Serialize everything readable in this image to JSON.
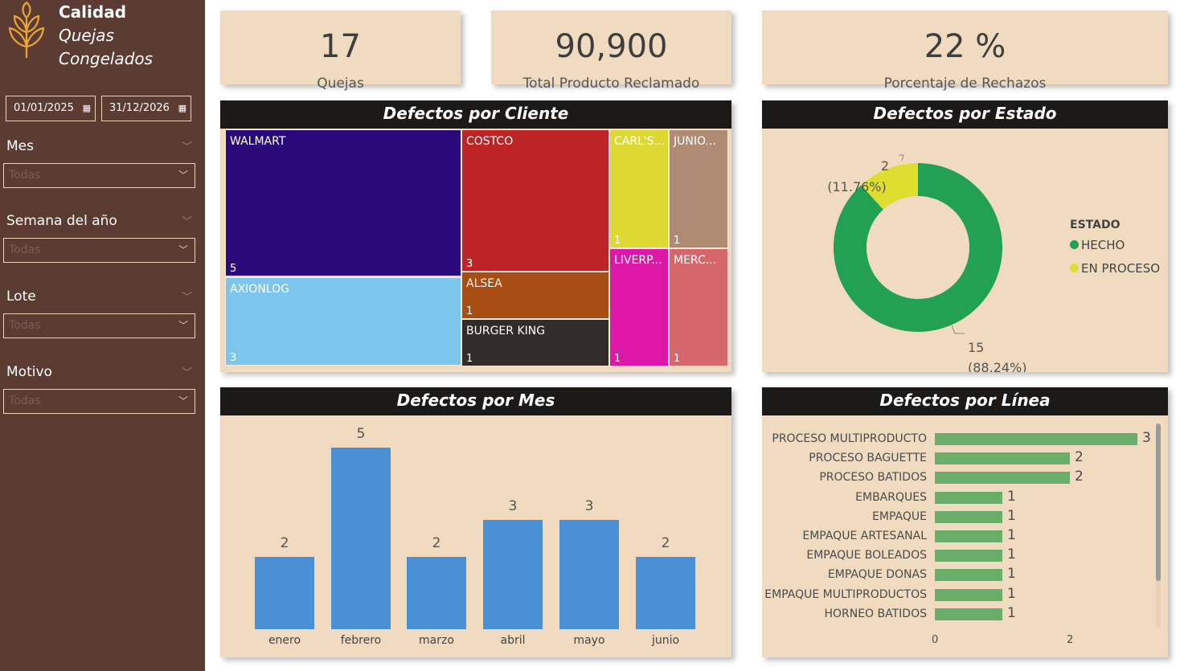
{
  "brand": {
    "line1": "Calidad",
    "line2": "Quejas",
    "line3": "Congelados"
  },
  "filters": {
    "date_from": "01/01/2025",
    "date_to": "31/12/2026",
    "slicers": [
      {
        "label": "Mes",
        "value": "Todas"
      },
      {
        "label": "Semana del año",
        "value": "Todas"
      },
      {
        "label": "Lote",
        "value": "Todas"
      },
      {
        "label": "Motivo",
        "value": "Todas"
      }
    ]
  },
  "kpis": [
    {
      "value": "17",
      "label": "Quejas"
    },
    {
      "value": "90,900",
      "label": "Total Producto Reclamado"
    },
    {
      "value": "22 %",
      "label": "Porcentaje de Rechazos"
    }
  ],
  "colors": {
    "sidebar": "#5c3b32",
    "card": "#f0dbc0",
    "title_bar": "#1c1a19",
    "bar_blue": "#4b90d4",
    "bar_green": "#6bae6b",
    "hecho": "#22a152",
    "en_proceso": "#dede30"
  },
  "panels": {
    "cliente_title": "Defectos por Cliente",
    "estado_title": "Defectos por Estado",
    "mes_title": "Defectos por Mes",
    "linea_title": "Defectos por Línea"
  },
  "treemap": [
    {
      "name": "WALMART",
      "count": "5",
      "color": "#2a0a7a"
    },
    {
      "name": "AXIONLOG",
      "count": "3",
      "color": "#7cc6ee"
    },
    {
      "name": "COSTCO",
      "count": "3",
      "color": "#be2426"
    },
    {
      "name": "ALSEA",
      "count": "1",
      "color": "#a84d13"
    },
    {
      "name": "BURGER KING",
      "count": "1",
      "color": "#332a2a"
    },
    {
      "name": "CARL'S...",
      "count": "1",
      "color": "#ddd932"
    },
    {
      "name": "JUNIO...",
      "count": "1",
      "color": "#ae8b72"
    },
    {
      "name": "LIVERP...",
      "count": "1",
      "color": "#dd17a8"
    },
    {
      "name": "MERC...",
      "count": "1",
      "color": "#d5676a"
    }
  ],
  "donut": {
    "legend_title": "ESTADO",
    "items": [
      {
        "name": "HECHO",
        "value": 15,
        "label_count": "15",
        "label_pct": "(88.24%)"
      },
      {
        "name": "EN PROCESO",
        "value": 2,
        "label_count": "2",
        "label_pct": "(11.76%)"
      }
    ]
  },
  "chart_data": [
    {
      "type": "bar",
      "title": "Defectos por Mes",
      "categories": [
        "enero",
        "febrero",
        "marzo",
        "abril",
        "mayo",
        "junio"
      ],
      "values": [
        2,
        5,
        2,
        3,
        3,
        2
      ],
      "ylim": [
        0,
        5.5
      ]
    },
    {
      "type": "bar",
      "title": "Defectos por Línea",
      "orientation": "horizontal",
      "categories": [
        "PROCESO MULTIPRODUCTO",
        "PROCESO BAGUETTE",
        "PROCESO BATIDOS",
        "EMBARQUES",
        "EMPAQUE",
        "EMPAQUE ARTESANAL",
        "EMPAQUE BOLEADOS",
        "EMPAQUE DONAS",
        "EMPAQUE MULTIPRODUCTOS",
        "HORNEO BATIDOS"
      ],
      "values": [
        3,
        2,
        2,
        1,
        1,
        1,
        1,
        1,
        1,
        1
      ],
      "xlim": [
        0,
        3
      ],
      "xticks": [
        "0",
        "2"
      ]
    }
  ]
}
